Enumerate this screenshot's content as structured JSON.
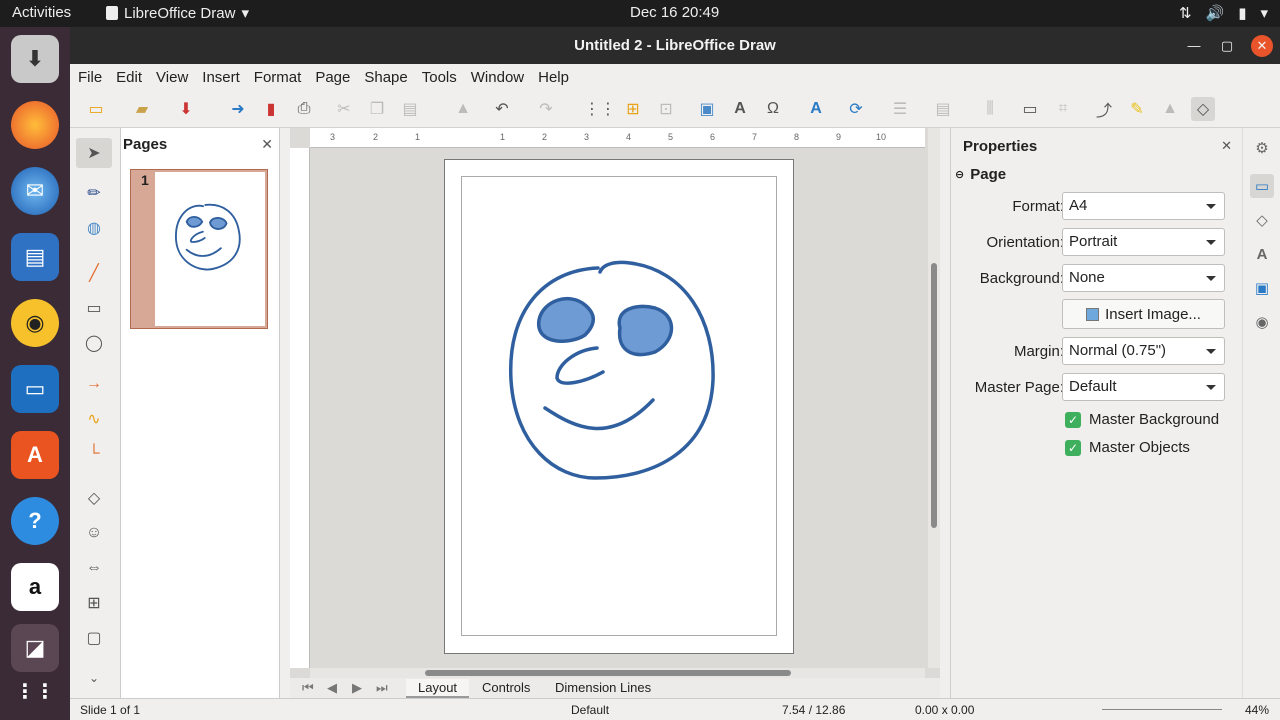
{
  "topbar": {
    "activities": "Activities",
    "app_name": "LibreOffice Draw",
    "clock": "Dec 16  20:49"
  },
  "window": {
    "title": "Untitled 2 - LibreOffice Draw"
  },
  "menu": [
    "File",
    "Edit",
    "View",
    "Insert",
    "Format",
    "Page",
    "Shape",
    "Tools",
    "Window",
    "Help"
  ],
  "pages_panel": {
    "title": "Pages",
    "thumb_number": "1"
  },
  "tabs": {
    "layout": "Layout",
    "controls": "Controls",
    "dimension_lines": "Dimension Lines"
  },
  "ruler": {
    "h_ticks": [
      "3",
      "2",
      "1",
      "1",
      "2",
      "3",
      "4",
      "5",
      "6",
      "7",
      "8",
      "9",
      "10"
    ],
    "v_ticks": [
      "1",
      "2",
      "3",
      "4",
      "5",
      "6",
      "7",
      "8",
      "9",
      "10",
      "11"
    ]
  },
  "properties": {
    "title": "Properties",
    "section": "Page",
    "format_label": "Format:",
    "format_value": "A4",
    "orientation_label": "Orientation:",
    "orientation_value": "Portrait",
    "background_label": "Background:",
    "background_value": "None",
    "insert_image": "Insert Image...",
    "margin_label": "Margin:",
    "margin_value": "Normal (0.75\")",
    "master_page_label": "Master Page:",
    "master_page_value": "Default",
    "master_background": "Master Background",
    "master_objects": "Master Objects"
  },
  "status": {
    "slide": "Slide 1 of 1",
    "master": "Default",
    "position": "7.54 / 12.86",
    "size": "0.00 x 0.00",
    "zoom": "44%"
  },
  "colors": {
    "drawing_stroke": "#2f5f9e",
    "drawing_fill": "#6f9bd4",
    "titlebar": "#2b2b2b",
    "close_button": "#e9542b"
  }
}
